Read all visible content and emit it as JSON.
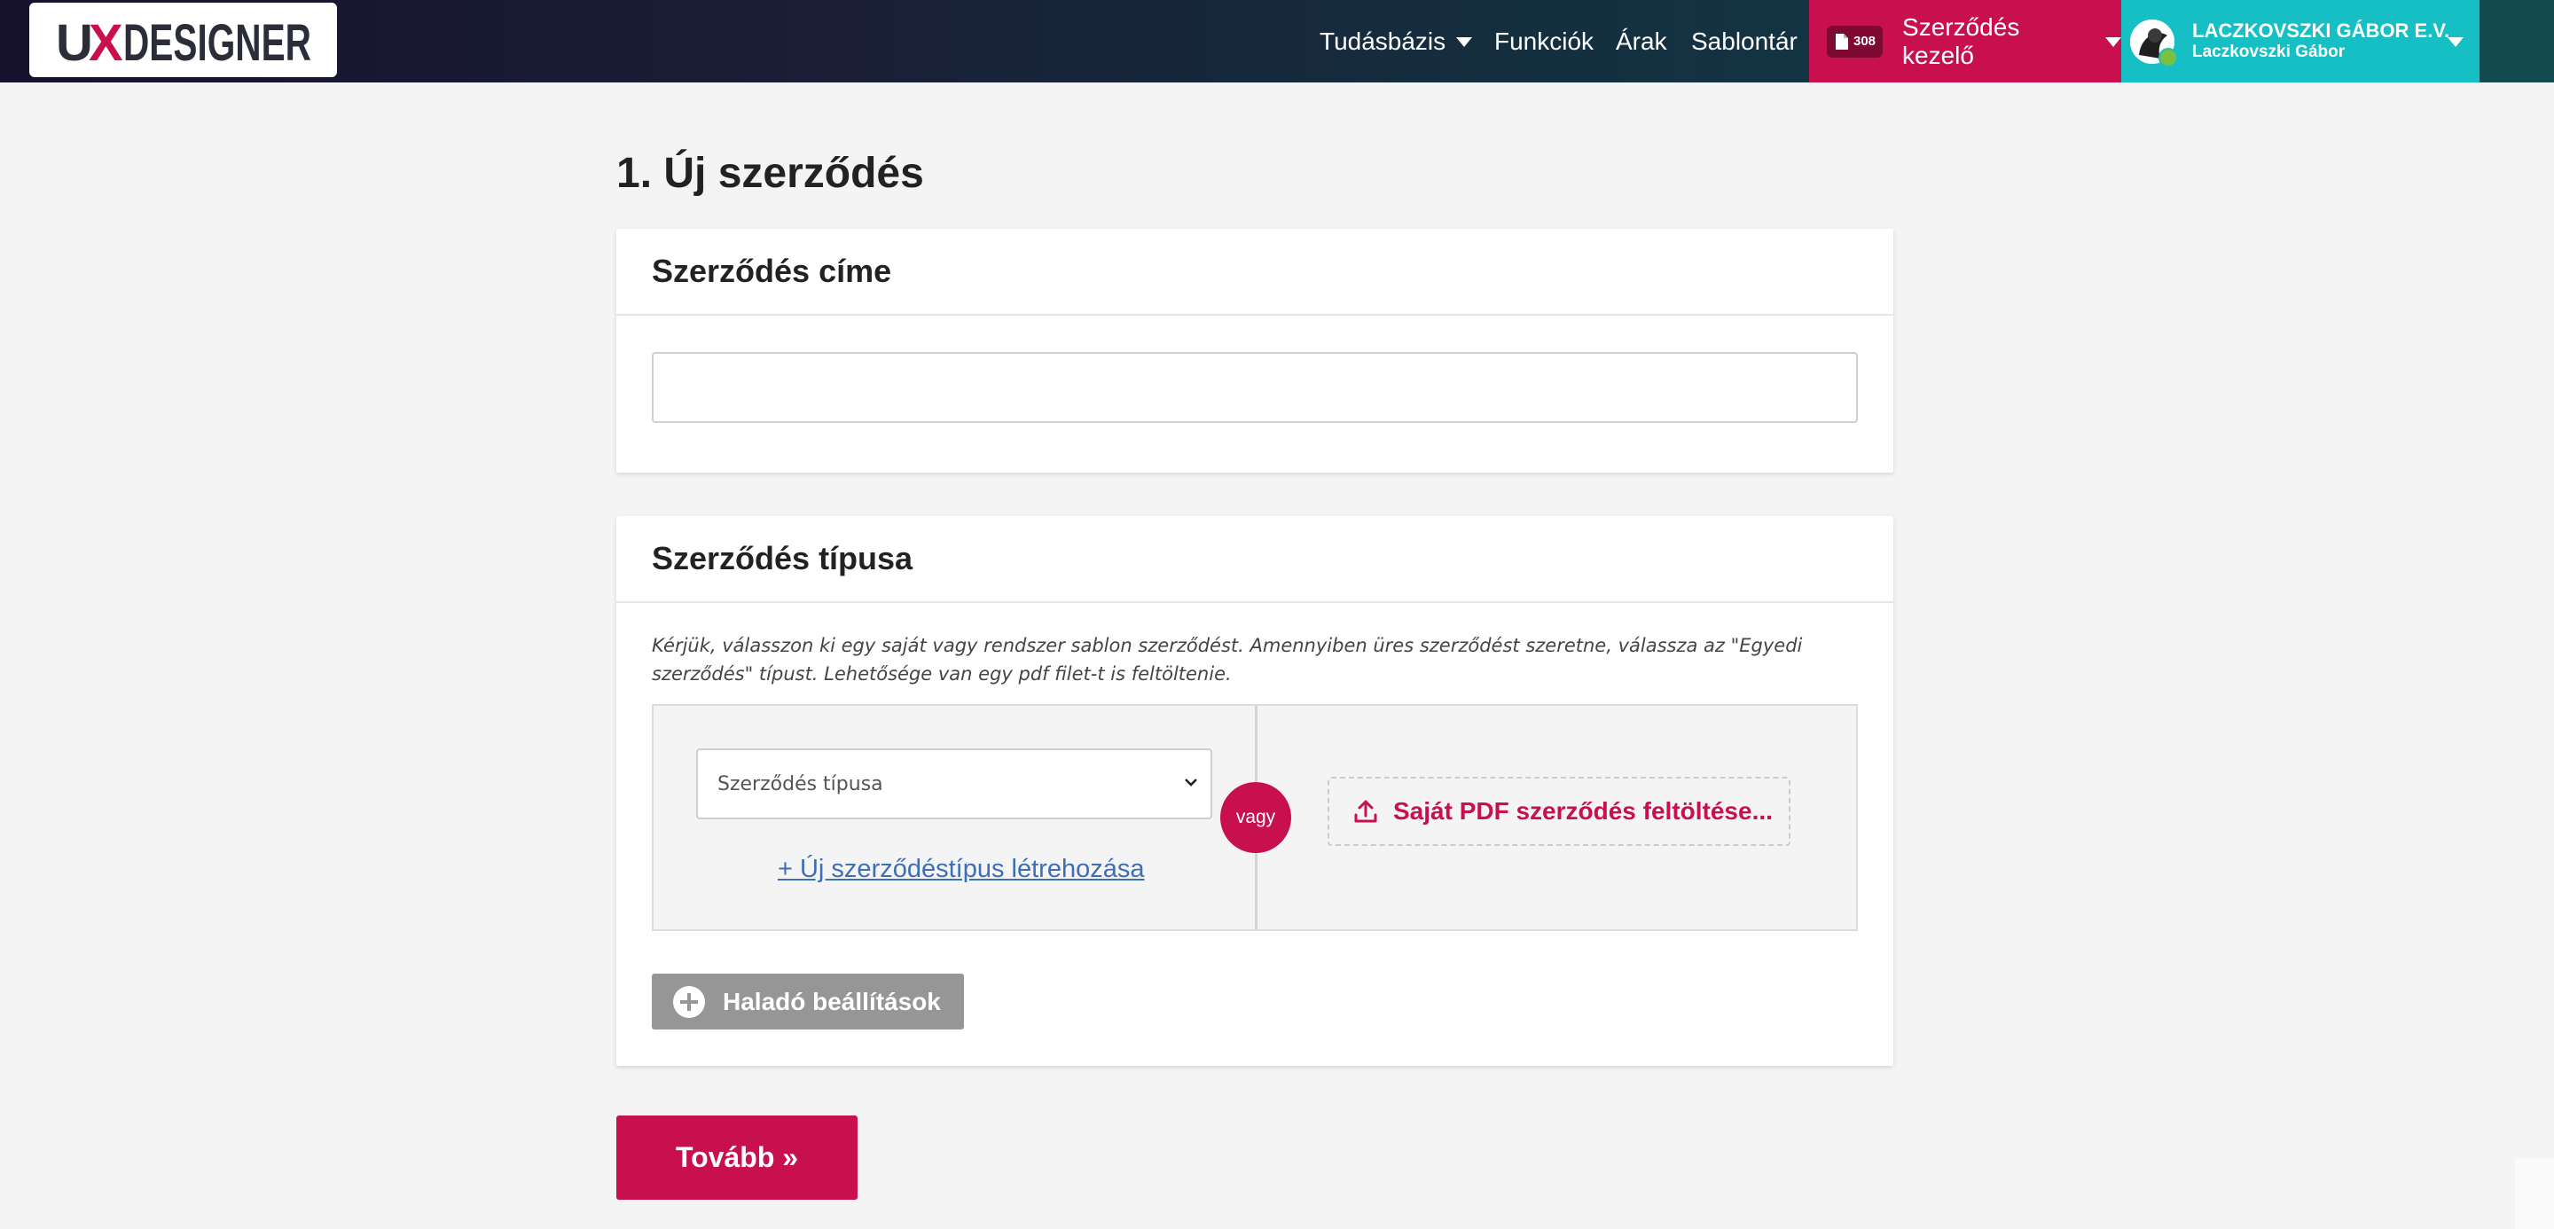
{
  "header": {
    "logo_text": "UXDESIGNER",
    "nav": [
      {
        "label": "Tudásbázis"
      },
      {
        "label": "Funkciók"
      },
      {
        "label": "Árak"
      },
      {
        "label": "Sablontár"
      }
    ],
    "contract_manager": {
      "count": "308",
      "label": "Szerződés kezelő"
    },
    "user": {
      "company": "LACZKOVSZKI GÁBOR E.V.",
      "name": "Laczkovszki Gábor"
    }
  },
  "page_title": "1. Új szerződés",
  "title_card": {
    "heading": "Szerződés címe",
    "value": ""
  },
  "type_card": {
    "heading": "Szerződés típusa",
    "hint": "Kérjük, válasszon ki egy saját vagy rendszer sablon szerződést. Amennyiben üres szerződést szeretne, válassza az \"Egyedi szerződés\" típust. Lehetősége van egy pdf filet-t is feltöltenie.",
    "select_placeholder": "Szerződés típusa",
    "new_type_link": "+ Új szerződéstípus létrehozása",
    "or_label": "vagy",
    "upload_label": "Saját PDF szerződés feltöltése...",
    "advanced_label": "Haladó beállítások"
  },
  "next_button": "Tovább »",
  "colors": {
    "accent": "#c8104f",
    "user_bg": "#15bfc4",
    "link": "#3d6fb6",
    "muted_button": "#969696"
  },
  "icons": {
    "upload": "upload-icon",
    "advanced": "plus-circle-icon",
    "select": "chevron-down-icon",
    "contract_badge": "document-icon"
  }
}
